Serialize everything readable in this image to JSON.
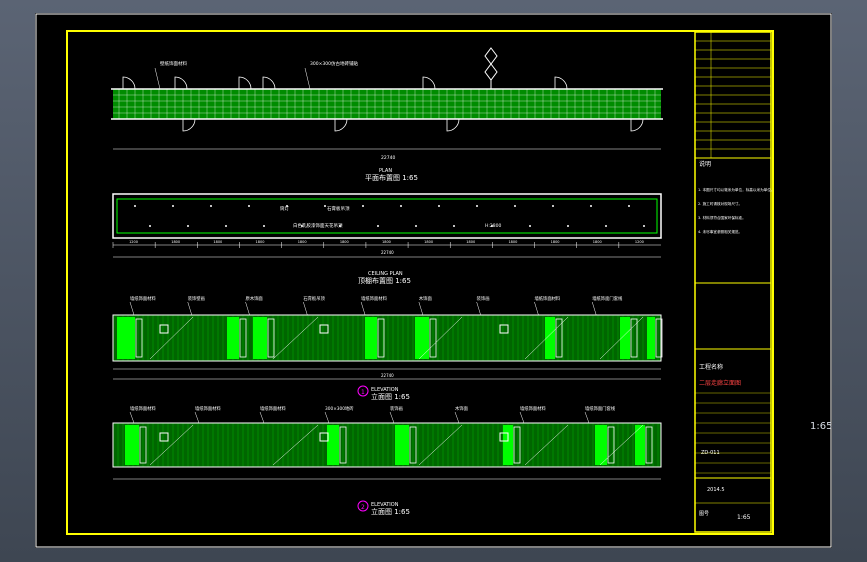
{
  "sheet": {
    "scale_readout": "1:65"
  },
  "plan": {
    "title": "平面布置图 1:65",
    "subtitle": "PLAN",
    "total_dim": "22740",
    "note_top_left": "壁纸饰面材料",
    "note_top_mid": "300×300仿古地砖铺贴"
  },
  "ceiling": {
    "title": "顶棚布置图 1:65",
    "subtitle": "CEILING PLAN",
    "total_dim": "22740",
    "note_a": "筒灯",
    "note_b": "石膏板吊顶",
    "note_c": "白色乳胶漆饰面天花吊顶",
    "note_d": "H:2800",
    "dims": [
      "1200",
      "1800",
      "1800",
      "1800",
      "1800",
      "1800",
      "1800",
      "1800",
      "1800",
      "1800",
      "1800",
      "1800",
      "1200"
    ]
  },
  "elevation1": {
    "marker": "1",
    "title": "立面图 1:65",
    "subtitle": "ELEVATION",
    "total_dim": "22740",
    "labels": [
      "墙纸饰面材料",
      "装饰壁画",
      "原木饰面",
      "石膏板吊顶",
      "墙纸饰面材料",
      "木饰面",
      "装饰画",
      "墙纸饰面材料",
      "墙纸饰面门套线"
    ]
  },
  "elevation2": {
    "marker": "2",
    "title": "立面图 1:65",
    "subtitle": "ELEVATION",
    "labels": [
      "墙纸饰面材料",
      "墙纸饰面材料",
      "墙纸饰面材料",
      "300×300地砖",
      "装饰画",
      "木饰面",
      "墙纸饰面材料",
      "墙纸饰面门套线"
    ]
  },
  "title_block": {
    "project_label": "工程名称",
    "drawing_name": "二层走廊立面图",
    "notes_header": "说明",
    "drawing_no": "ZD-011",
    "date": "2014.5",
    "scale": "1:65",
    "sheet_label": "图号",
    "notes": [
      "1. 本图尺寸均以毫米为单位，标高以米为单位。",
      "2. 施工时请核对现场尺寸。",
      "3. 材料须符合国家环保标准。",
      "4. 未尽事宜参照相关规范。"
    ]
  },
  "colors": {
    "frame": "#ffff00",
    "accent": "#00ff00",
    "line": "#ffffff",
    "cyan": "#00ffff",
    "magenta": "#ff00ff",
    "background": "#000000"
  }
}
